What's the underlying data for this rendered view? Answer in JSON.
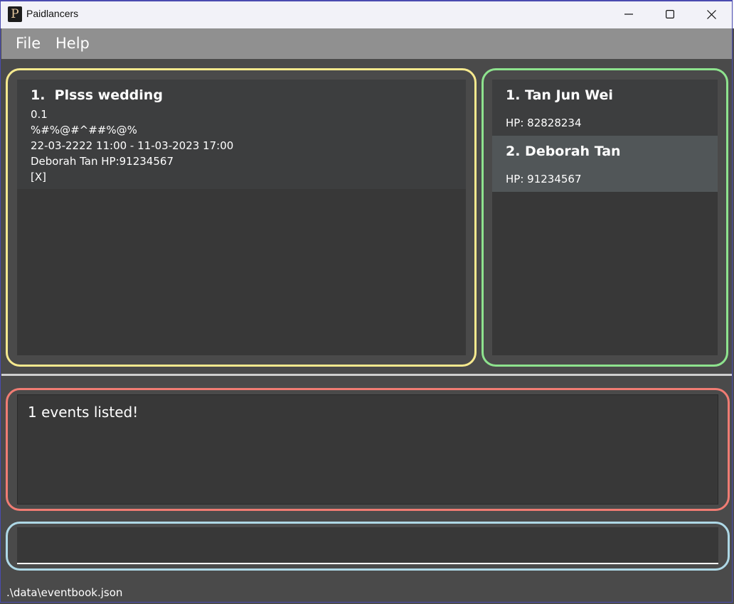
{
  "window": {
    "title": "Paidlancers",
    "icon": "paidlancers-app-icon",
    "controls": [
      "minimize-icon",
      "maximize-icon",
      "close-icon"
    ]
  },
  "menu": {
    "file_label": "File",
    "help_label": "Help"
  },
  "events": [
    {
      "title": "1.  Plsss wedding",
      "rate": "0.1",
      "address": "%#%@#^##%@%",
      "timing": "22-03-2222 11:00 - 11-03-2023 17:00",
      "client": "Deborah Tan HP:91234567",
      "status": "[X]"
    }
  ],
  "persons": [
    {
      "name": "1. Tan Jun Wei",
      "phone": "HP: 82828234"
    },
    {
      "name": "2. Deborah Tan",
      "phone": "HP: 91234567"
    }
  ],
  "result": {
    "message": "1 events listed!"
  },
  "command": {
    "value": ""
  },
  "status_bar": {
    "path": ".\\data\\eventbook.json"
  },
  "colors": {
    "events_frame": "#f6e98e",
    "persons_frame": "#8ee38e",
    "result_frame": "#f07c73",
    "command_frame": "#aed8e6",
    "selected_person": "#515658"
  }
}
